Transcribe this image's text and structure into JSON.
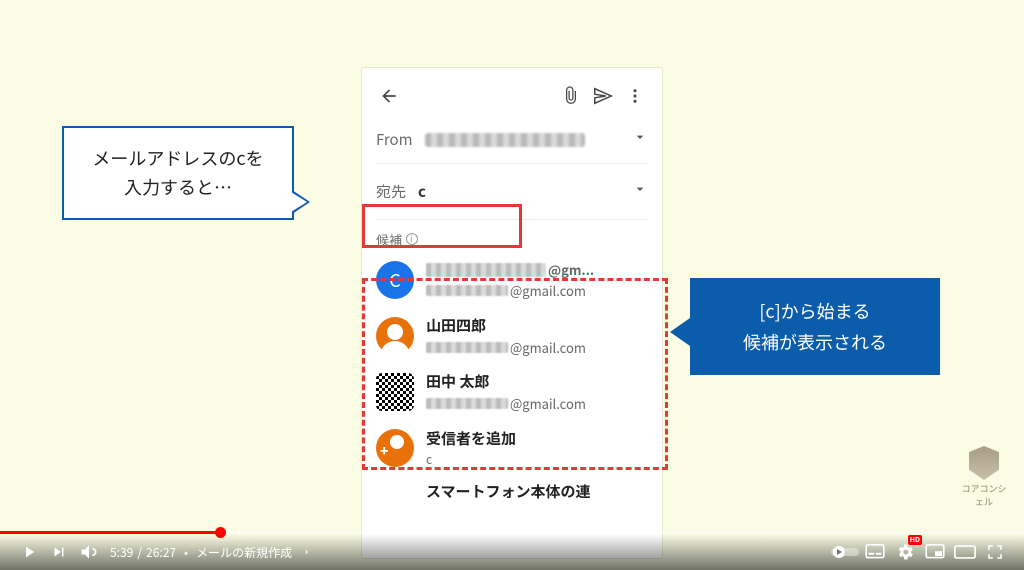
{
  "callouts": {
    "left_line1": "メールアドレスのcを",
    "left_line2": "入力すると…",
    "right_line1": "[c]から始まる",
    "right_line2": "候補が表示される"
  },
  "phone": {
    "from_label": "From",
    "to_label": "宛先",
    "to_value": "c",
    "cand_header": "候補",
    "suggestions": [
      {
        "avatar_letter": "C",
        "name_suffix": "@gm...",
        "mail_suffix": "@gmail.com"
      },
      {
        "name": "山田四郎",
        "mail_suffix": "@gmail.com"
      },
      {
        "name": "田中 太郎",
        "mail_suffix": "@gmail.com"
      }
    ],
    "add_recipient": {
      "label": "受信者を追加",
      "sub": "c"
    },
    "more_row": "スマートフォン本体の連"
  },
  "watermark": "コアコンシェル",
  "player": {
    "current": "5:39",
    "duration": "26:27",
    "chapter": "メールの新規作成",
    "hd": "HD"
  }
}
